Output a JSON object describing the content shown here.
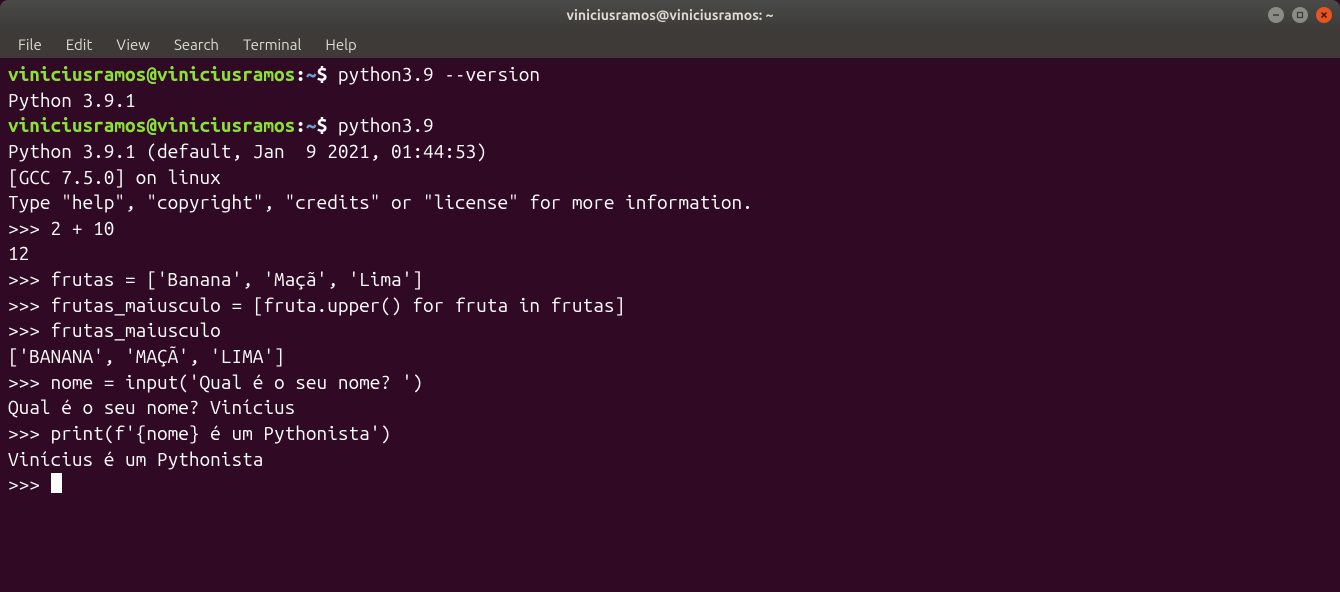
{
  "titlebar": {
    "title": "viniciusramos@viniciusramos: ~"
  },
  "menubar": {
    "items": [
      "File",
      "Edit",
      "View",
      "Search",
      "Terminal",
      "Help"
    ]
  },
  "prompt": {
    "userhost": "viniciusramos@viniciusramos",
    "colon": ":",
    "path": "~",
    "dollar": "$"
  },
  "lines": [
    {
      "type": "prompt",
      "cmd": " python3.9 --version"
    },
    {
      "type": "out",
      "text": "Python 3.9.1"
    },
    {
      "type": "prompt",
      "cmd": " python3.9"
    },
    {
      "type": "out",
      "text": "Python 3.9.1 (default, Jan  9 2021, 01:44:53) "
    },
    {
      "type": "out",
      "text": "[GCC 7.5.0] on linux"
    },
    {
      "type": "out",
      "text": "Type \"help\", \"copyright\", \"credits\" or \"license\" for more information."
    },
    {
      "type": "out",
      "text": ">>> 2 + 10"
    },
    {
      "type": "out",
      "text": "12"
    },
    {
      "type": "out",
      "text": ">>> frutas = ['Banana', 'Maçã', 'Lima']"
    },
    {
      "type": "out",
      "text": ">>> frutas_maiusculo = [fruta.upper() for fruta in frutas]"
    },
    {
      "type": "out",
      "text": ">>> frutas_maiusculo"
    },
    {
      "type": "out",
      "text": "['BANANA', 'MAÇÃ', 'LIMA']"
    },
    {
      "type": "out",
      "text": ">>> nome = input('Qual é o seu nome? ')"
    },
    {
      "type": "out",
      "text": "Qual é o seu nome? Vinícius"
    },
    {
      "type": "out",
      "text": ">>> print(f'{nome} é um Pythonista')"
    },
    {
      "type": "out",
      "text": "Vinícius é um Pythonista"
    },
    {
      "type": "cursor",
      "text": ">>> "
    }
  ]
}
